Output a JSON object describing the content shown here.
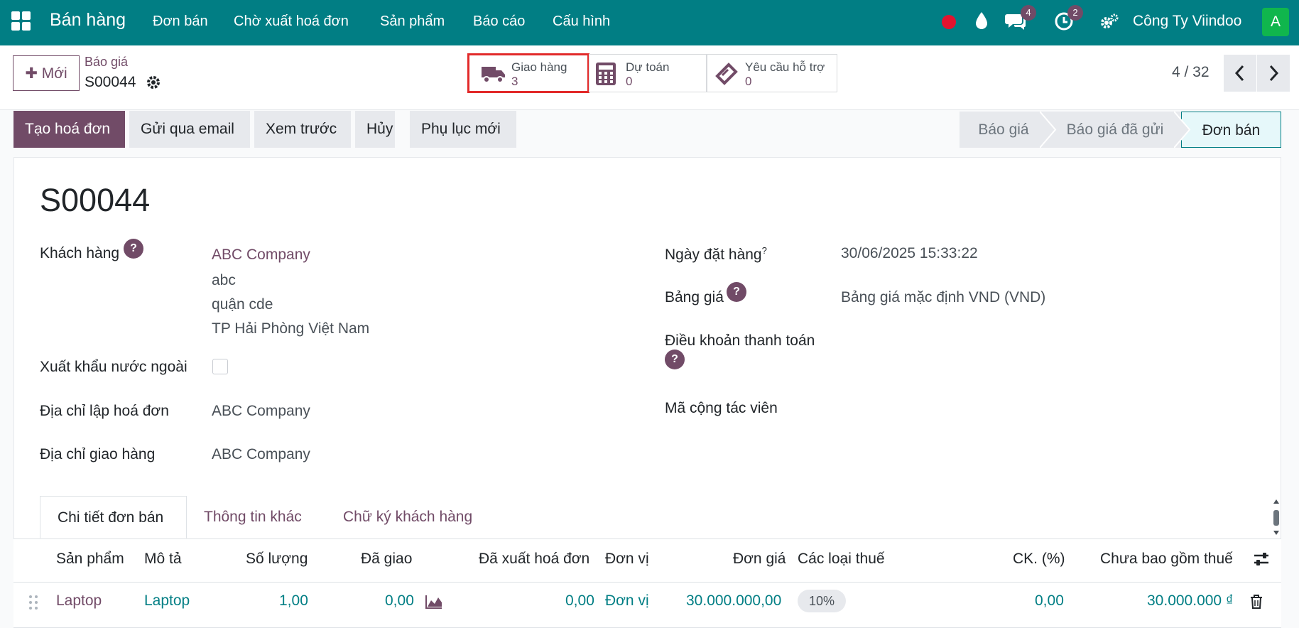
{
  "navbar": {
    "app_name": "Bán hàng",
    "menus": [
      "Đơn bán",
      "Chờ xuất hoá đơn",
      "Sản phẩm",
      "Báo cáo",
      "Cấu hình"
    ],
    "messages_count": "4",
    "activities_count": "2",
    "company": "Công Ty Viindoo",
    "avatar_letter": "A",
    "accent": "#017e84",
    "brand": "#714b67"
  },
  "control": {
    "new_label": "Mới",
    "breadcrumb_parent": "Báo giá",
    "record_name": "S00044",
    "smart_buttons": [
      {
        "label": "Giao hàng",
        "value": "3",
        "icon": "truck-icon"
      },
      {
        "label": "Dự toán",
        "value": "0",
        "icon": "calculator-icon"
      },
      {
        "label": "Yêu cầu hỗ trợ",
        "value": "0",
        "icon": "ticket-icon"
      }
    ],
    "pager": "4 / 32"
  },
  "actions": [
    "Tạo hoá đơn",
    "Gửi qua email",
    "Xem trước",
    "Hủy",
    "Phụ lục mới"
  ],
  "statusbar": [
    "Báo giá",
    "Báo giá đã gửi",
    "Đơn bán"
  ],
  "form": {
    "title": "S00044",
    "customer_label": "Khách hàng",
    "customer_name": "ABC Company",
    "customer_address": [
      "abc",
      "quận cde",
      "TP Hải Phòng Việt Nam"
    ],
    "export_label": "Xuất khẩu nước ngoài",
    "invoice_addr_label": "Địa chỉ lập hoá đơn",
    "invoice_addr": "ABC Company",
    "delivery_addr_label": "Địa chỉ giao hàng",
    "delivery_addr": "ABC Company",
    "order_date_label": "Ngày đặt hàng",
    "order_date": "30/06/2025 15:33:22",
    "pricelist_label": "Bảng giá",
    "pricelist": "Bảng giá mặc định VND (VND)",
    "payment_terms_label": "Điều khoản thanh toán",
    "collaborator_label": "Mã cộng tác viên",
    "help_glyph": "?"
  },
  "tabs": [
    "Chi tiết đơn bán",
    "Thông tin khác",
    "Chữ ký khách hàng"
  ],
  "table": {
    "headers": [
      "Sản phẩm",
      "Mô tả",
      "Số lượng",
      "Đã giao",
      "Đã xuất hoá đơn",
      "Đơn vị",
      "Đơn giá",
      "Các loại thuế",
      "CK. (%)",
      "Chưa bao gồm thuế"
    ],
    "rows": [
      {
        "product": "Laptop",
        "description": "Laptop",
        "qty": "1,00",
        "delivered": "0,00",
        "invoiced": "0,00",
        "uom": "Đơn vị",
        "price": "30.000.000,00",
        "tax": "10%",
        "discount": "0,00",
        "subtotal": "30.000.000 ₫"
      }
    ]
  }
}
